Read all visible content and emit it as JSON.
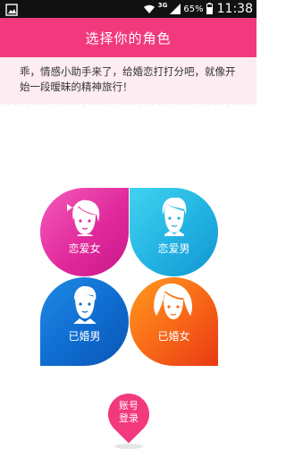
{
  "status_bar": {
    "network": "3G",
    "battery": "65%",
    "time": "11:38",
    "icons": [
      "gallery-icon",
      "wifi-icon",
      "signal-icon",
      "battery-icon"
    ]
  },
  "title_bar": {
    "title": "选择你的角色",
    "color": "#f2397d"
  },
  "banner": {
    "text": "乖，情感小助手来了，给婚恋打打分吧，就像开始一段暧昧的精神旅行！"
  },
  "roles": [
    {
      "label": "恋爱女",
      "icon": "girl-avatar-icon",
      "color": "#e12a9c"
    },
    {
      "label": "恋爱男",
      "icon": "boy-avatar-icon",
      "color": "#22b2e2"
    },
    {
      "label": "已婚男",
      "icon": "man-avatar-icon",
      "color": "#0f6cd0"
    },
    {
      "label": "已婚女",
      "icon": "woman-avatar-icon",
      "color": "#f96a18"
    }
  ],
  "login_button": {
    "label": "账号\n登录"
  }
}
